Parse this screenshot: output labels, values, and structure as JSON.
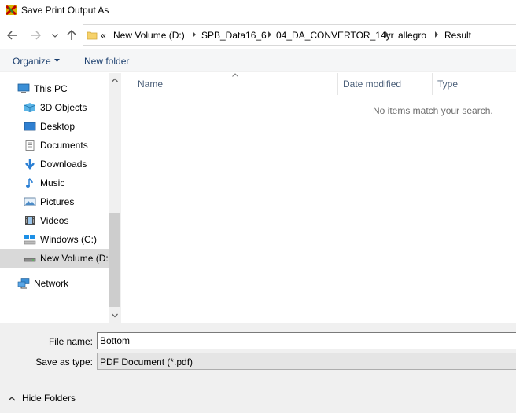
{
  "window": {
    "title": "Save Print Output As",
    "icon": "allegro-app-icon"
  },
  "nav": {
    "back_icon": "arrow-left-icon",
    "forward_icon": "arrow-right-icon",
    "recent_icon": "chevron-down-icon",
    "up_icon": "arrow-up-icon",
    "address": {
      "overflow": "«",
      "crumbs": [
        "New Volume (D:)",
        "SPB_Data16_6",
        "04_DA_CONVERTOR_14yr",
        "allegro",
        "Result"
      ]
    }
  },
  "toolbar": {
    "organize_label": "Organize",
    "new_folder_label": "New folder"
  },
  "sidebar": {
    "items": [
      {
        "label": "This PC",
        "icon": "computer-icon"
      },
      {
        "label": "3D Objects",
        "icon": "cube-icon"
      },
      {
        "label": "Desktop",
        "icon": "desktop-icon"
      },
      {
        "label": "Documents",
        "icon": "document-icon"
      },
      {
        "label": "Downloads",
        "icon": "download-icon"
      },
      {
        "label": "Music",
        "icon": "music-icon"
      },
      {
        "label": "Pictures",
        "icon": "picture-icon"
      },
      {
        "label": "Videos",
        "icon": "film-icon"
      },
      {
        "label": "Windows (C:)",
        "icon": "windows-drive-icon"
      },
      {
        "label": "New Volume (D:",
        "icon": "drive-icon"
      },
      {
        "label": "Network",
        "icon": "network-icon"
      }
    ]
  },
  "files": {
    "columns": [
      "Name",
      "Date modified",
      "Type"
    ],
    "empty_message": "No items match your search."
  },
  "form": {
    "filename_label": "File name:",
    "filename_value": "Bottom",
    "filetype_label": "Save as type:",
    "filetype_value": "PDF Document (*.pdf)"
  },
  "footer": {
    "hide_folders_label": "Hide Folders"
  },
  "colors": {
    "accent": "#1a3e6e",
    "selected_bg": "#d9d9d9",
    "chrome_bg": "#f0f0f0"
  }
}
